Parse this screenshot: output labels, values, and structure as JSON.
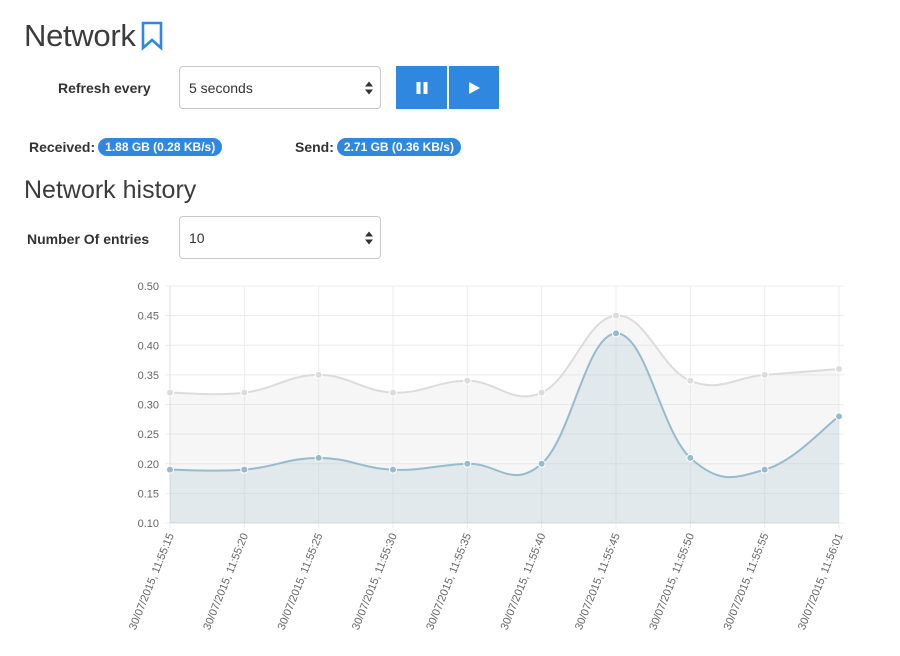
{
  "page": {
    "title": "Network",
    "bookmark_icon": "bookmark-icon"
  },
  "refresh": {
    "label": "Refresh every",
    "selected": "5 seconds",
    "pause_icon": "pause-icon",
    "play_icon": "play-icon"
  },
  "stats": {
    "received_label": "Received:",
    "received_value": "1.88 GB (0.28 KB/s)",
    "send_label": "Send:",
    "send_value": "2.71 GB (0.36 KB/s)"
  },
  "history": {
    "title": "Network history",
    "entries_label": "Number Of entries",
    "entries_selected": "10"
  },
  "colors": {
    "accent": "#2f87e0",
    "send_line": "#dcdcdc",
    "received_line": "#97bbcd"
  },
  "chart_data": {
    "type": "line",
    "x": [
      "30/07/2015, 11:55:15",
      "30/07/2015, 11:55:20",
      "30/07/2015, 11:55:25",
      "30/07/2015, 11:55:30",
      "30/07/2015, 11:55:35",
      "30/07/2015, 11:55:40",
      "30/07/2015, 11:55:45",
      "30/07/2015, 11:55:50",
      "30/07/2015, 11:55:55",
      "30/07/2015, 11:56:01"
    ],
    "series": [
      {
        "values": [
          0.32,
          0.32,
          0.35,
          0.32,
          0.34,
          0.32,
          0.45,
          0.34,
          0.35,
          0.36
        ]
      },
      {
        "values": [
          0.19,
          0.19,
          0.21,
          0.19,
          0.2,
          0.2,
          0.42,
          0.21,
          0.19,
          0.28
        ]
      }
    ],
    "yticks": [
      "0.50",
      "0.45",
      "0.40",
      "0.35",
      "0.30",
      "0.25",
      "0.20",
      "0.15",
      "0.10"
    ],
    "ylim": [
      0.1,
      0.5
    ],
    "grid": true,
    "area_fill": true
  }
}
